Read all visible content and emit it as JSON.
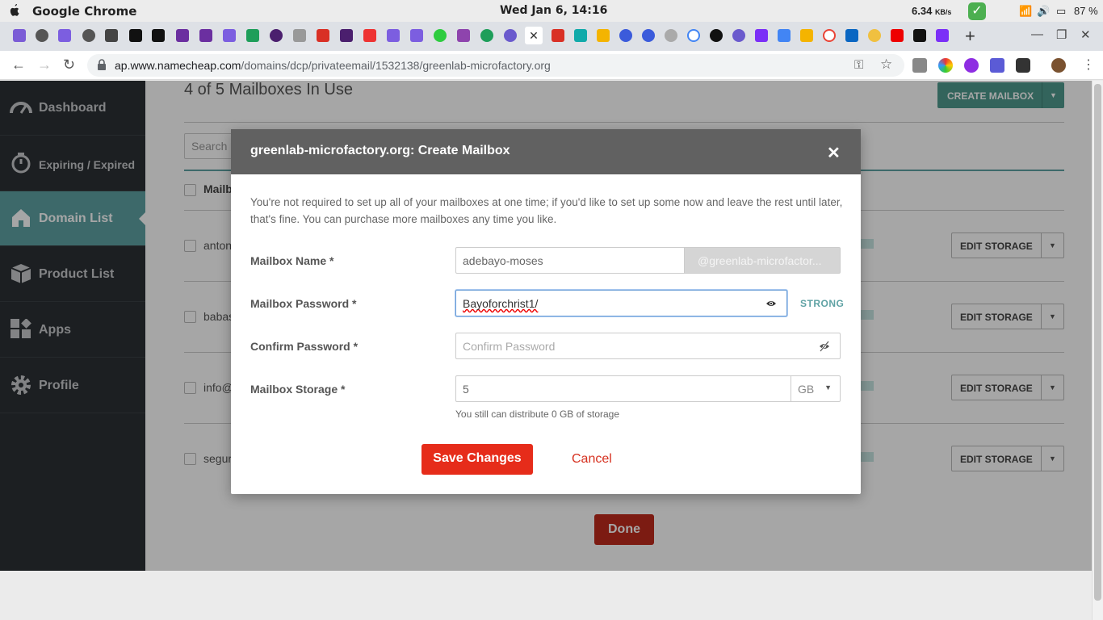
{
  "os": {
    "app_name": "Google Chrome",
    "clock": "Wed Jan  6, 14:16",
    "net_speed": "6.34",
    "net_unit": "KB/s",
    "battery": "87 %"
  },
  "browser": {
    "url_domain": "ap.www.namecheap.com",
    "url_path": "/domains/dcp/privateemail/1532138/greenlab-microfactory.org"
  },
  "sidebar": {
    "items": [
      {
        "label": "Dashboard"
      },
      {
        "label": "Expiring / Expired"
      },
      {
        "label": "Domain List"
      },
      {
        "label": "Product List"
      },
      {
        "label": "Apps"
      },
      {
        "label": "Profile"
      }
    ]
  },
  "main": {
    "title": "4 of 5 Mailboxes In Use",
    "create_label": "CREATE MAILBOX",
    "search_placeholder": "Search",
    "column_header": "Mailb",
    "rows": [
      {
        "text": "anton",
        "edit_label": "EDIT STORAGE"
      },
      {
        "text": "babas",
        "edit_label": "EDIT STORAGE"
      },
      {
        "text": "info@",
        "edit_label": "EDIT STORAGE"
      },
      {
        "text": "segur",
        "edit_label": "EDIT STORAGE"
      }
    ],
    "done_label": "Done"
  },
  "modal": {
    "title": "greenlab-microfactory.org: Create Mailbox",
    "close": "✕",
    "intro": "You're not required to set up all of your mailboxes at one time; if you'd like to set up some now and leave the rest until later, that's fine. You can purchase more mailboxes any time you like.",
    "mailbox_name_label": "Mailbox Name *",
    "mailbox_name_value": "adebayo-moses",
    "domain_suffix": "@greenlab-microfactor...",
    "password_label": "Mailbox Password *",
    "password_value": "Bayoforchrist1/",
    "password_strength": "STRONG",
    "confirm_label": "Confirm Password *",
    "confirm_placeholder": "Confirm Password",
    "storage_label": "Mailbox Storage *",
    "storage_value": "5",
    "storage_unit": "GB",
    "storage_help": "You still can distribute 0 GB of storage",
    "save_label": "Save Changes",
    "cancel_label": "Cancel"
  },
  "colors": {
    "sidebar_bg": "#2b3035",
    "sidebar_active": "#5fa2a4",
    "modal_header": "#616161",
    "save_button": "#e62c1a",
    "strong_indicator": "#5fa2a4"
  }
}
